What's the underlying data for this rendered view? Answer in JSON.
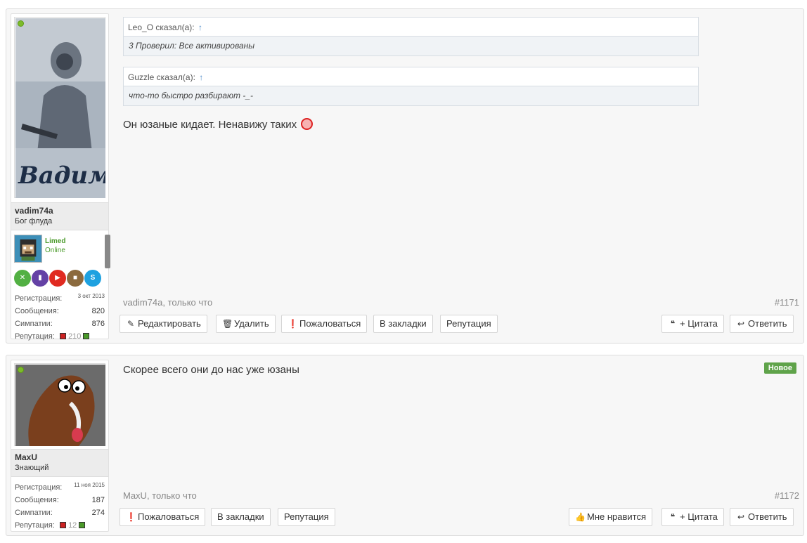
{
  "posts": [
    {
      "author": "vadim74a",
      "user_title": "Бог флуда",
      "online": true,
      "server": {
        "name": "Limed",
        "status": "Online"
      },
      "social": [
        "xbox-icon",
        "twitch-icon",
        "youtube-icon",
        "minecraft-icon",
        "skype-icon"
      ],
      "stats": {
        "reg_label": "Регистрация:",
        "reg_value": "3 окт 2013",
        "msg_label": "Сообщения:",
        "msg_value": "820",
        "like_label": "Симпатии:",
        "like_value": "876",
        "rep_label": "Репутация:",
        "rep_value": "210"
      },
      "quotes": [
        {
          "author": "Leo_O сказал(а):",
          "arrow": "↑",
          "text": "3 Проверил: Все активированы"
        },
        {
          "author": "Guzzle сказал(а):",
          "arrow": "↑",
          "text": "что-то быстро разбирают -_-"
        }
      ],
      "message": "Он юзаные кидает. Ненавижу таких",
      "meta": "vadim74a, только что",
      "number": "#1171",
      "buttons_left": [
        "Редактировать",
        "Удалить",
        "Пожаловаться",
        "В закладки",
        "Репутация"
      ],
      "buttons_right": [
        "+ Цитата",
        "Ответить"
      ]
    },
    {
      "author": "MaxU",
      "user_title": "Знающий",
      "online": true,
      "stats": {
        "reg_label": "Регистрация:",
        "reg_value": "11 ноя 2015",
        "msg_label": "Сообщения:",
        "msg_value": "187",
        "like_label": "Симпатии:",
        "like_value": "274",
        "rep_label": "Репутация:",
        "rep_value": "12"
      },
      "message": "Скорее всего они до нас уже юзаны",
      "new_badge": "Новое",
      "meta": "MaxU, только что",
      "number": "#1172",
      "buttons_left": [
        "Пожаловаться",
        "В закладки",
        "Репутация"
      ],
      "buttons_right": [
        "Мне нравится",
        "+ Цитата",
        "Ответить"
      ]
    }
  ],
  "colors": {
    "online": "#7dbb2a",
    "badge": "#5fa34a",
    "rep_negative": "#cc2222",
    "rep_positive": "#4a9a2a",
    "quote_arrow": "#4f8bc9"
  }
}
